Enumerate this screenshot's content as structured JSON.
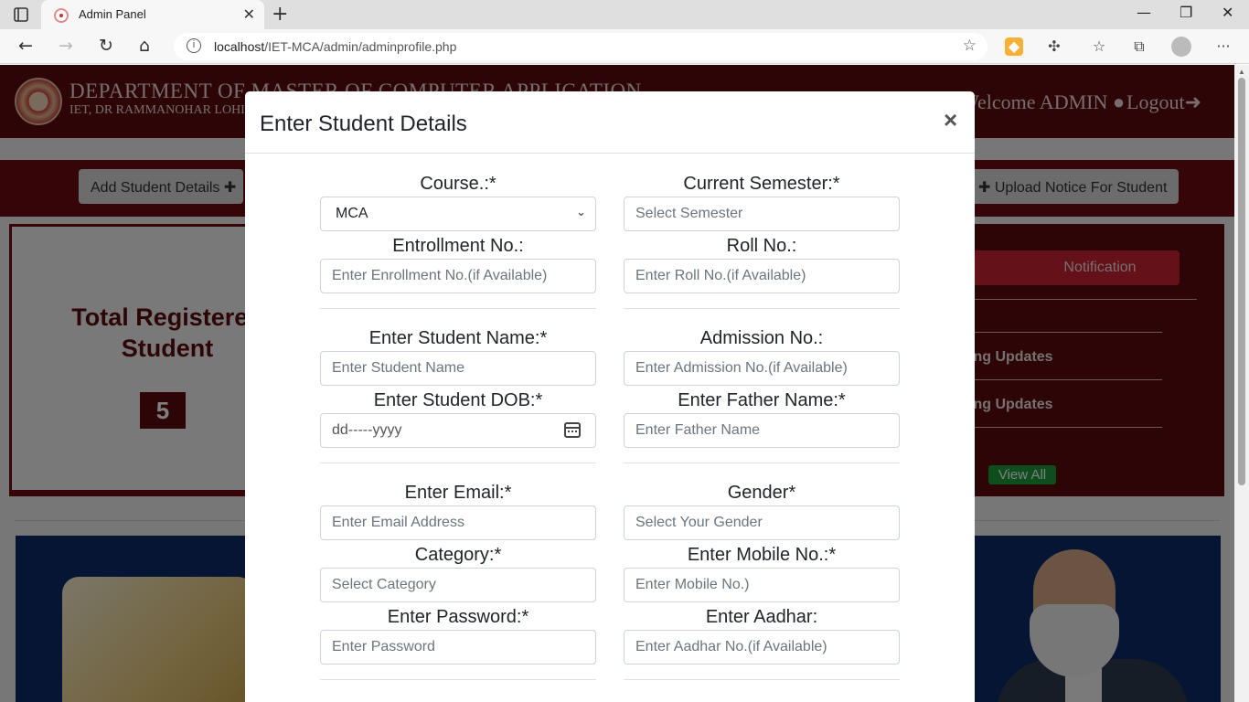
{
  "browser": {
    "tab_title": "Admin Panel",
    "url_host": "localhost",
    "url_path": "/IET-MCA/admin/adminprofile.php"
  },
  "header": {
    "dept_title": "DEPARTMENT OF MASTER OF COMPUTER APPLICATION",
    "dept_subtitle": "IET, DR RAMMANOHAR LOHIA",
    "welcome": "Welcome ADMIN",
    "logout": "Logout"
  },
  "actions": {
    "add_student": "Add Student Details",
    "upload_notice": "Upload Notice For Student"
  },
  "stats": {
    "title_line1": "Total Registered",
    "title_line2": "Student",
    "count": "5"
  },
  "notifications": {
    "button": "Notification",
    "items": [
      "ing Updates",
      "ing Updates"
    ],
    "view_all": "View All"
  },
  "modal": {
    "title": "Enter Student Details",
    "close": "×",
    "fields": {
      "course_label": "Course.:*",
      "course_value": "MCA",
      "semester_label": "Current Semester:*",
      "semester_placeholder": "Select Semester",
      "enrollment_label": "Entrollment No.:",
      "enrollment_placeholder": "Enter Enrollment No.(if Available)",
      "roll_label": "Roll No.:",
      "roll_placeholder": "Enter Roll No.(if Available)",
      "name_label": "Enter Student Name:*",
      "name_placeholder": "Enter Student Name",
      "admission_label": "Admission No.:",
      "admission_placeholder": "Enter Admission No.(if Available)",
      "dob_label": "Enter Student DOB:*",
      "dob_placeholder": "dd-----yyyy",
      "father_label": "Enter Father Name:*",
      "father_placeholder": "Enter Father Name",
      "email_label": "Enter Email:*",
      "email_placeholder": "Enter Email Address",
      "gender_label": "Gender*",
      "gender_placeholder": "Select Your Gender",
      "category_label": "Category:*",
      "category_placeholder": "Select Category",
      "mobile_label": "Enter Mobile No.:*",
      "mobile_placeholder": "Enter Mobile No.)",
      "password_label": "Enter Password:*",
      "password_placeholder": "Enter Password",
      "aadhar_label": "Enter Aadhar:",
      "aadhar_placeholder": "Enter Aadhar No.(if Available)"
    }
  },
  "colors": {
    "brand_maroon": "#5b0a0e",
    "notification_red": "#c82333",
    "view_all_green": "#1d9c3a"
  }
}
